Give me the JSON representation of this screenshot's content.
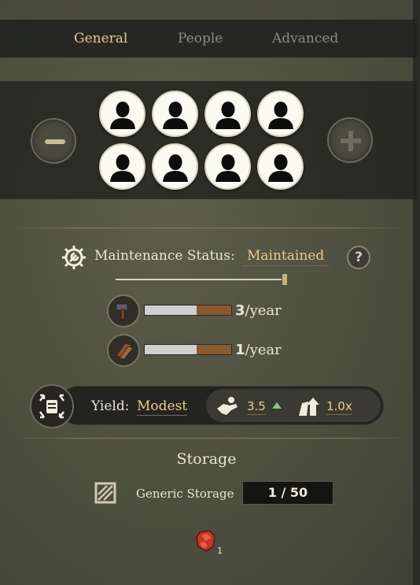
{
  "tabs": [
    {
      "label": "General",
      "active": true
    },
    {
      "label": "People",
      "active": false
    },
    {
      "label": "Advanced",
      "active": false
    }
  ],
  "workers": {
    "slot_icon": "person-silhouette-icon",
    "remove_icon": "minus-icon",
    "add_icon": "plus-icon"
  },
  "maintenance": {
    "label": "Maintenance Status:",
    "value": "Maintained",
    "help_label": "?",
    "slider_level": 1.0,
    "resources": [
      {
        "icon": "hammer-icon",
        "bar_fill": 0.4,
        "amount": "3",
        "unit": "/year"
      },
      {
        "icon": "wood-planks-icon",
        "bar_fill": 0.4,
        "amount": "1",
        "unit": "/year"
      }
    ]
  },
  "yield": {
    "label": "Yield:",
    "value": "Modest",
    "productivity": "3.5",
    "multiplier": "1.0x",
    "trend": "up",
    "trend_color": "#8fc58a"
  },
  "storage": {
    "title": "Storage",
    "label": "Generic Storage",
    "value": "1 / 50",
    "item_icon": "iron-ore-icon",
    "item_count": "1"
  },
  "colors": {
    "accent_gold": "#eccb8e",
    "active_tab": "#e3c8a3",
    "inactive_tab": "#8e8c7f",
    "bar_fill": "#8a5a2c"
  }
}
